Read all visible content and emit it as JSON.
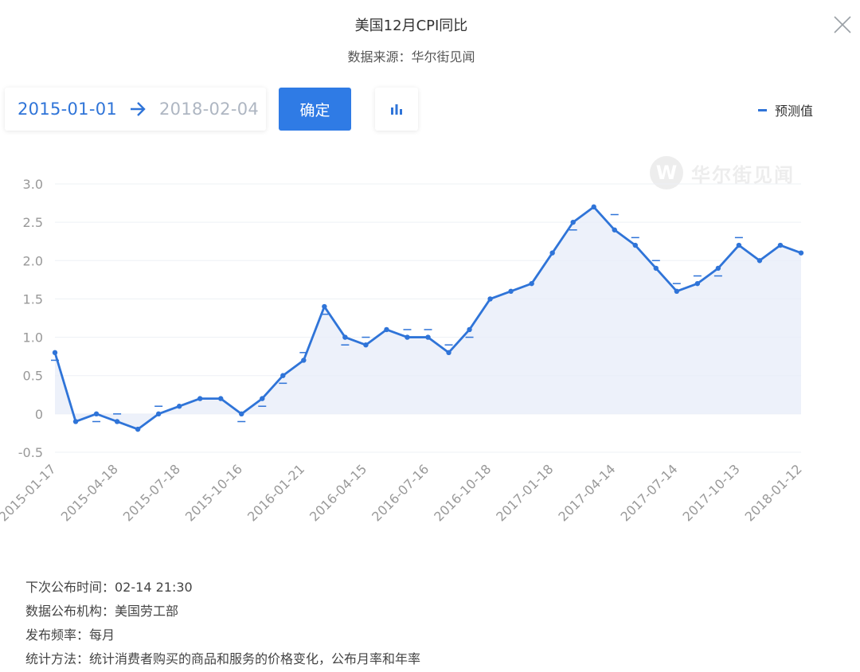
{
  "header": {
    "title": "美国12月CPI同比",
    "source": "数据来源：华尔街见闻"
  },
  "controls": {
    "start_date": "2015-01-01",
    "end_date": "2018-02-04",
    "confirm_label": "确定"
  },
  "legend": {
    "label": "预测值"
  },
  "watermark": {
    "logo": "W",
    "text": "华尔街见闻"
  },
  "colors": {
    "accent": "#2f74d8",
    "button": "#2f7be5",
    "area": "#e8eef9",
    "grid": "#edf0f5"
  },
  "chart_data": {
    "type": "line",
    "ylim": [
      -0.5,
      3.0
    ],
    "yticks": [
      -0.5,
      0,
      0.5,
      1.0,
      1.5,
      2.0,
      2.5,
      3.0
    ],
    "ytick_labels": [
      "-0.5",
      "0",
      "0.5",
      "1.0",
      "1.5",
      "2.0",
      "2.5",
      "3.0"
    ],
    "xtick_labels": [
      "2015-01-17",
      "2015-04-18",
      "2015-07-18",
      "2015-10-16",
      "2016-01-21",
      "2016-04-15",
      "2016-07-16",
      "2016-10-18",
      "2017-01-18",
      "2017-04-14",
      "2017-07-14",
      "2017-10-13",
      "2018-01-12"
    ],
    "xtick_indices": [
      0,
      3,
      6,
      9,
      12,
      15,
      18,
      21,
      24,
      27,
      30,
      33,
      36
    ],
    "series": [
      {
        "name": "",
        "values": [
          0.8,
          -0.1,
          0.0,
          -0.1,
          -0.2,
          0.0,
          0.1,
          0.2,
          0.2,
          0.0,
          0.2,
          0.5,
          0.7,
          1.4,
          1.0,
          0.9,
          1.1,
          1.0,
          1.0,
          0.8,
          1.1,
          1.5,
          1.6,
          1.7,
          2.1,
          2.5,
          2.7,
          2.4,
          2.2,
          1.9,
          1.6,
          1.7,
          1.9,
          2.2,
          2.0,
          2.2,
          2.1
        ]
      },
      {
        "name": "预测值",
        "values": [
          0.7,
          null,
          -0.1,
          0.0,
          null,
          0.1,
          null,
          null,
          null,
          -0.1,
          0.1,
          0.4,
          0.8,
          1.3,
          0.9,
          1.0,
          null,
          1.1,
          1.1,
          0.9,
          1.0,
          null,
          null,
          null,
          null,
          2.4,
          null,
          2.6,
          2.3,
          2.0,
          1.7,
          1.8,
          1.8,
          2.3,
          null,
          null,
          null
        ]
      }
    ],
    "grid": true
  },
  "info": {
    "next_release": "下次公布时间：02-14 21:30",
    "agency": "数据公布机构：美国劳工部",
    "frequency": "发布频率：每月",
    "method": "统计方法：统计消费者购买的商品和服务的价格变化，公布月率和年率"
  }
}
